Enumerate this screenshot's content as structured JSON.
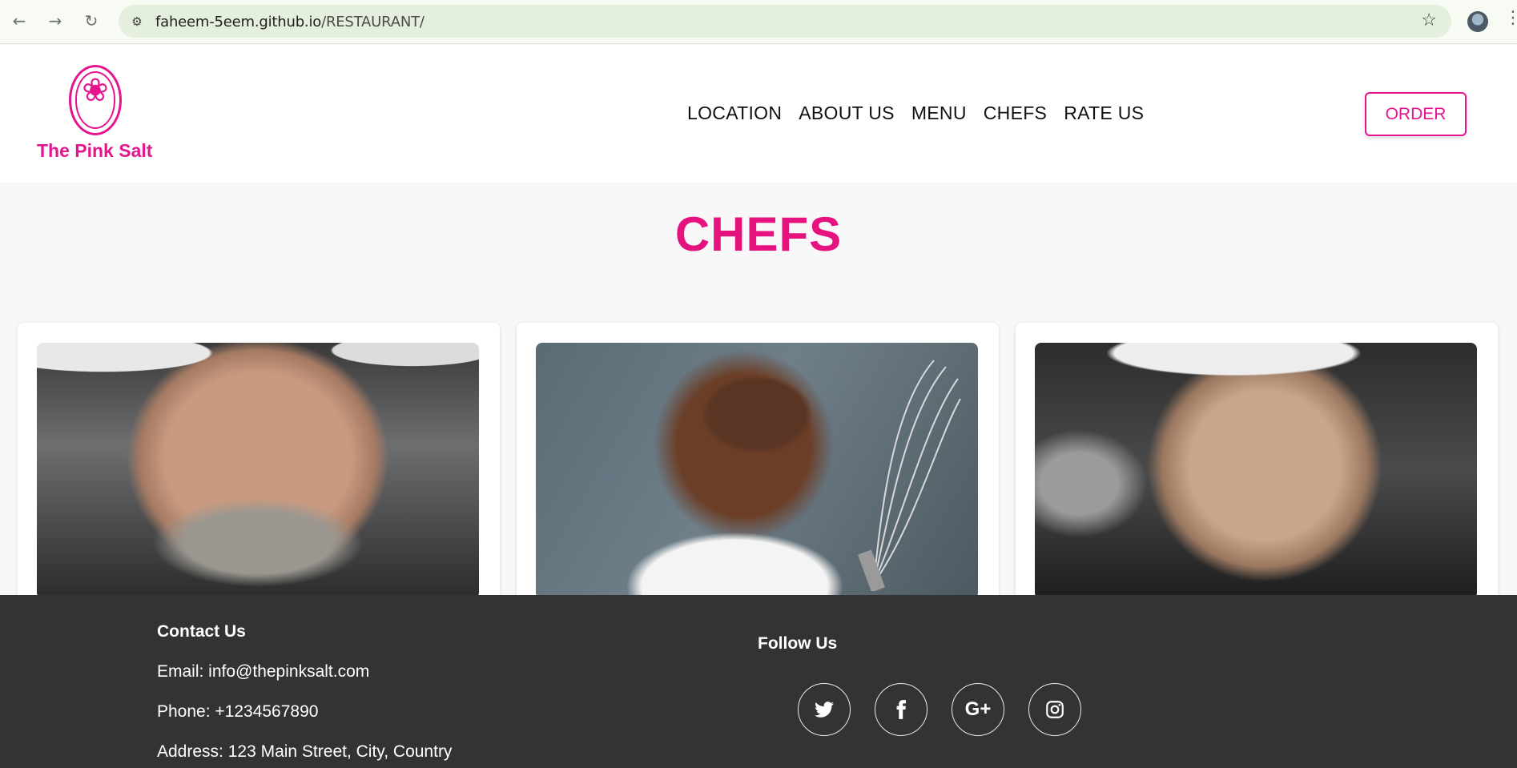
{
  "browser": {
    "url_host": "faheem-5eem.github.io",
    "url_path": "/RESTAURANT/"
  },
  "brand": {
    "name": "The Pink Salt",
    "accent_color": "#e5158f"
  },
  "nav": {
    "items": [
      {
        "label": "LOCATION"
      },
      {
        "label": "ABOUT US"
      },
      {
        "label": "MENU"
      },
      {
        "label": "CHEFS"
      },
      {
        "label": "RATE US"
      }
    ],
    "order_label": "ORDER"
  },
  "page": {
    "title": "CHEFS"
  },
  "chefs": [
    {
      "image_icon": "chef-portrait"
    },
    {
      "image_icon": "chef-portrait"
    },
    {
      "image_icon": "chef-portrait"
    }
  ],
  "footer": {
    "contact_title": "Contact Us",
    "email": "Email: info@thepinksalt.com",
    "phone": "Phone: +1234567890",
    "address": "Address: 123 Main Street, City, Country",
    "follow_title": "Follow Us",
    "social": [
      {
        "icon": "twitter-icon"
      },
      {
        "icon": "facebook-icon"
      },
      {
        "icon": "google-plus-icon",
        "glyph": "G+"
      },
      {
        "icon": "instagram-icon"
      }
    ]
  }
}
